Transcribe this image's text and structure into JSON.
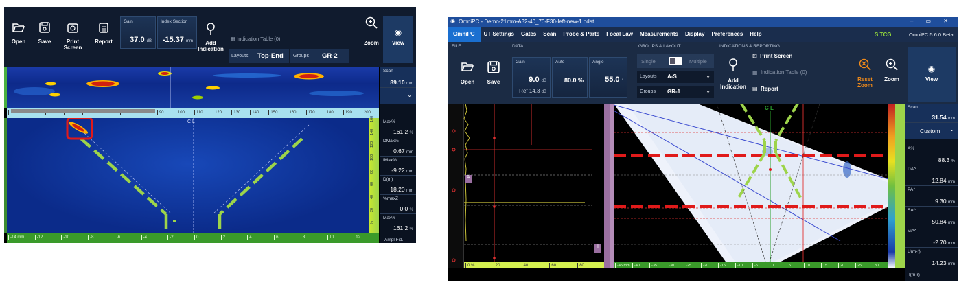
{
  "left": {
    "toolbar": {
      "open": "Open",
      "save": "Save",
      "print": "Print Screen",
      "report": "Report",
      "gain_label": "Gain",
      "gain_value": "37.0",
      "gain_unit": "dB",
      "index_label": "Index Section",
      "index_value": "-15.37",
      "index_unit": "mm",
      "add_indication": "Add Indication",
      "indication_table": "Indication Table (0)",
      "layouts_label": "Layouts",
      "layouts_value": "Top-End",
      "groups_label": "Groups",
      "groups_value": "GR-2",
      "zoom": "Zoom",
      "view": "View"
    },
    "scan": {
      "label": "Scan",
      "value": "89.10",
      "unit": "mm"
    },
    "readouts": [
      {
        "key": "Max%",
        "value": "161.2",
        "unit": "%"
      },
      {
        "key": "DMax%",
        "value": "0.67",
        "unit": "mm"
      },
      {
        "key": "IMax%",
        "value": "-9.22",
        "unit": "mm"
      },
      {
        "key": "D(m)",
        "value": "18.20",
        "unit": "mm"
      },
      {
        "key": "%maxZ",
        "value": "0.0",
        "unit": "%"
      },
      {
        "key": "Max%",
        "value": "161.2",
        "unit": "%"
      }
    ],
    "footer_label": "Ampl.Fid.",
    "top_ruler": [
      "10 mm",
      "20",
      "30",
      "40",
      "50",
      "60",
      "70",
      "80",
      "90",
      "100",
      "110",
      "120",
      "130",
      "140",
      "150",
      "160",
      "170",
      "180",
      "190",
      "200"
    ],
    "bottom_ruler": [
      "-14 mm",
      "-12",
      "-10",
      "-8",
      "-6",
      "-4",
      "-2",
      "0",
      "2",
      "4",
      "6",
      "8",
      "10",
      "12"
    ],
    "cl": "C L",
    "side_ticks": [
      "160",
      "140",
      "120",
      "100",
      "80",
      "60",
      "40",
      "20",
      "%"
    ]
  },
  "right": {
    "titlebar": "OmniPC - Demo-21mm-A32-40_70-F30-left-new-1.odat",
    "menu": [
      "OmniPC",
      "UT Settings",
      "Gates",
      "Scan",
      "Probe & Parts",
      "Focal Law",
      "Measurements",
      "Display",
      "Preferences",
      "Help"
    ],
    "tcg": "S  TCG",
    "version": "OmniPC 5.6.0 Beta",
    "sections": {
      "file": "FILE",
      "data": "DATA",
      "groups_layout": "GROUPS & LAYOUT",
      "indications": "INDICATIONS & REPORTING"
    },
    "open": "Open",
    "save": "Save",
    "gain_label": "Gain",
    "gain_value": "9.0",
    "gain_unit": "dB",
    "gain_ref": "Ref 14.3",
    "gain_ref_unit": "dB",
    "auto_label": "Auto",
    "auto_value": "80.0 %",
    "angle_label": "Angle",
    "angle_value": "55.0",
    "angle_unit": "°",
    "single": "Single",
    "multiple": "Multiple",
    "layouts_label": "Layouts",
    "layouts_value": "A-S",
    "groups_label": "Groups",
    "groups_value": "GR-1",
    "add_indication": "Add Indication",
    "print_screen": "Print Screen",
    "indication_table": "Indication Table (0)",
    "report": "Report",
    "reset_zoom": "Reset Zoom",
    "zoom": "Zoom",
    "view": "View",
    "scan": {
      "label": "Scan",
      "value": "31.54",
      "unit": "mm"
    },
    "custom": "Custom",
    "readouts": [
      {
        "key": "A%",
        "value": "88.3",
        "unit": "%"
      },
      {
        "key": "DA^",
        "value": "12.84",
        "unit": "mm"
      },
      {
        "key": "PA^",
        "value": "9.30",
        "unit": "mm"
      },
      {
        "key": "SA^",
        "value": "50.84",
        "unit": "mm"
      },
      {
        "key": "ViA^",
        "value": "-2.70",
        "unit": "mm"
      },
      {
        "key": "U(m-r)",
        "value": "14.23",
        "unit": "mm"
      }
    ],
    "footer_label": "I(m-r)",
    "cl": "C L",
    "ascan_ruler": [
      "0 %",
      "20",
      "40",
      "60",
      "80"
    ],
    "bottom_ruler": [
      "-45 mm",
      "-40",
      "-35",
      "-30",
      "-25",
      "-20",
      "-15",
      "-10",
      "-5",
      "0",
      "5",
      "10",
      "15",
      "20",
      "25",
      "30"
    ],
    "gate_a": "A",
    "gate_i": "I",
    "gate_b": "B"
  },
  "colors": {
    "accent_blue": "#1a6fd0",
    "gate_green": "#9dd44a",
    "gate_red": "#e01a1a",
    "ruler_green": "#8fcf3c",
    "ruler_cyan": "#a8e1ef"
  }
}
